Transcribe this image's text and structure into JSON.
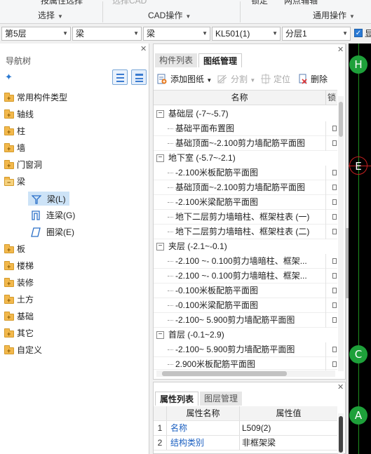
{
  "ribbon": {
    "cut_labels": [
      "按属性选择",
      "选择CAD",
      "锁定",
      "两点辅轴"
    ],
    "groups": [
      "选择",
      "CAD操作",
      "通用操作"
    ]
  },
  "selectors": {
    "floor": "第5层",
    "type": "梁",
    "subtype": "梁",
    "component": "KL501(1)",
    "layer": "分层1",
    "show_label": "显"
  },
  "nav": {
    "title": "导航树",
    "items": [
      {
        "label": "常用构件类型"
      },
      {
        "label": "轴线"
      },
      {
        "label": "柱"
      },
      {
        "label": "墙"
      },
      {
        "label": "门窗洞"
      },
      {
        "label": "梁"
      },
      {
        "label": "板"
      },
      {
        "label": "楼梯"
      },
      {
        "label": "装修"
      },
      {
        "label": "土方"
      },
      {
        "label": "基础"
      },
      {
        "label": "其它"
      },
      {
        "label": "自定义"
      }
    ],
    "beam_children": [
      {
        "label": "梁(L)",
        "icon": "beam-icon",
        "selected": true
      },
      {
        "label": "连梁(G)",
        "icon": "coupling-beam-icon",
        "selected": false
      },
      {
        "label": "圈梁(E)",
        "icon": "ring-beam-icon",
        "selected": false
      }
    ]
  },
  "drawings": {
    "tabs": [
      "构件列表",
      "图纸管理"
    ],
    "toolbar": {
      "add": "添加图纸",
      "split": "分割",
      "locate": "定位",
      "delete": "删除"
    },
    "col_name": "名称",
    "col_lock": "锁",
    "groups": [
      {
        "label": "基础层 (-7~-5.7)",
        "rows": [
          "基础平面布置图",
          "基础顶面~-2.100剪力墙配筋平面图"
        ]
      },
      {
        "label": "地下室 (-5.7~-2.1)",
        "rows": [
          "-2.100米板配筋平面图",
          "基础顶面~-2.100剪力墙配筋平面图",
          "-2.100米梁配筋平面图",
          "地下二层剪力墙暗柱、框架柱表 (一)",
          "地下二层剪力墙暗柱、框架柱表 (二)"
        ]
      },
      {
        "label": "夹层 (-2.1~-0.1)",
        "rows": [
          "-2.100   ~-  0.100剪力墙暗柱、框架...",
          "-2.100   ~-  0.100剪力墙暗柱、框架...",
          "-0.100米板配筋平面图",
          "-0.100米梁配筋平面图",
          "-2.100~   5.900剪力墙配筋平面图"
        ]
      },
      {
        "label": "首层 (-0.1~2.9)",
        "rows": [
          "-2.100~   5.900剪力墙配筋平面图",
          "2.900米板配筋平面图"
        ]
      }
    ]
  },
  "properties": {
    "tabs": [
      "属性列表",
      "图层管理"
    ],
    "col_attr": "属性名称",
    "col_val": "属性值",
    "rows": [
      {
        "n": "1",
        "attr": "名称",
        "val": "L509(2)"
      },
      {
        "n": "2",
        "attr": "结构类别",
        "val": "非框架梁"
      }
    ]
  },
  "canvas": {
    "axis_labels": [
      "H",
      "E",
      "C",
      "A"
    ]
  }
}
